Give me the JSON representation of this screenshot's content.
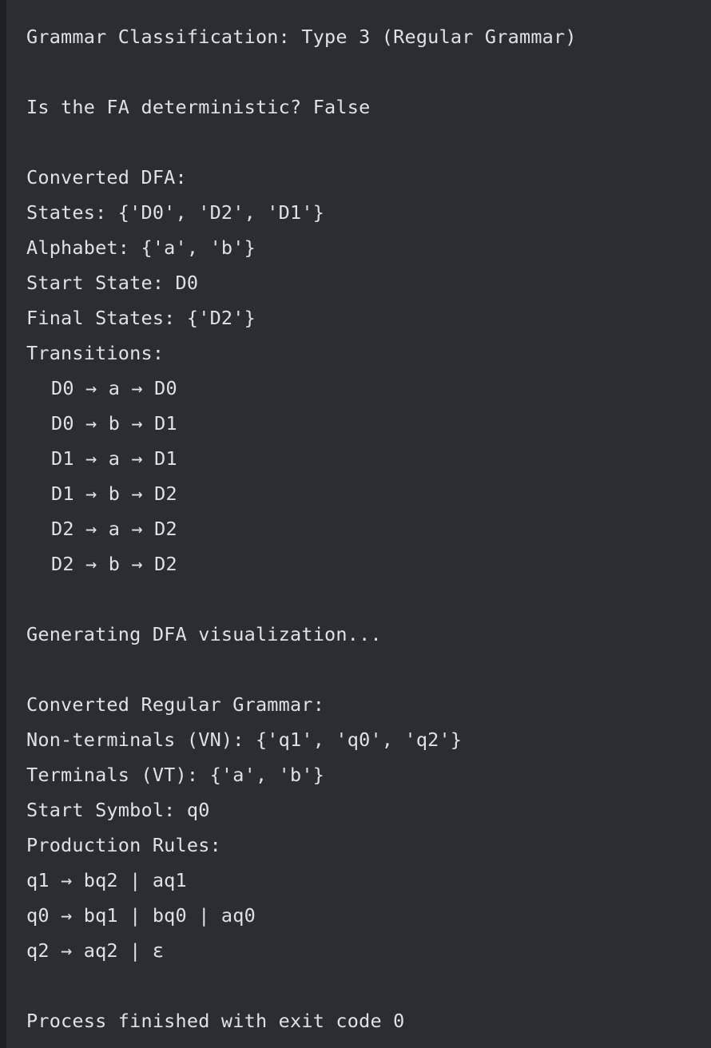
{
  "console": {
    "classification": "Grammar Classification: Type 3 (Regular Grammar)",
    "deterministic": "Is the FA deterministic? False",
    "dfa": {
      "heading": "Converted DFA:",
      "states": "States: {'D0', 'D2', 'D1'}",
      "alphabet": "Alphabet: {'a', 'b'}",
      "start_state": "Start State: D0",
      "final_states": "Final States: {'D2'}",
      "transitions_heading": "Transitions:",
      "transitions": [
        "D0 → a → D0",
        "D0 → b → D1",
        "D1 → a → D1",
        "D1 → b → D2",
        "D2 → a → D2",
        "D2 → b → D2"
      ]
    },
    "visualization": "Generating DFA visualization...",
    "grammar": {
      "heading": "Converted Regular Grammar:",
      "nonterminals": "Non-terminals (VN): {'q1', 'q0', 'q2'}",
      "terminals": "Terminals (VT): {'a', 'b'}",
      "start_symbol": "Start Symbol: q0",
      "rules_heading": "Production Rules:",
      "rules": [
        "q1 → bq2 | aq1",
        "q0 → bq1 | bq0 | aq0",
        "q2 → aq2 | ε"
      ]
    },
    "exit": "Process finished with exit code 0"
  }
}
